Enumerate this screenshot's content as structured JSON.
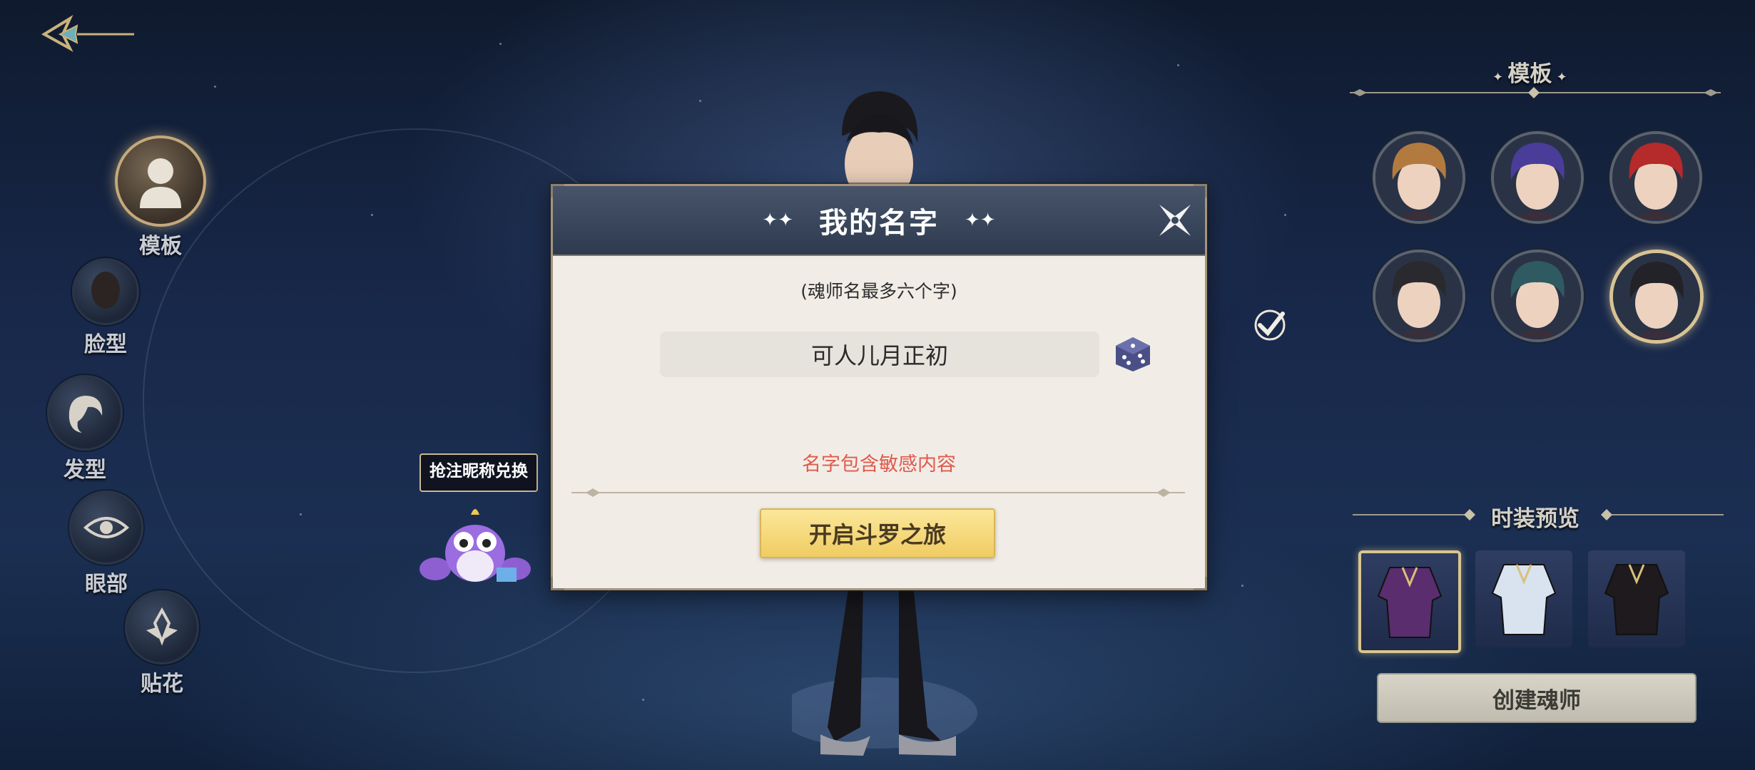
{
  "left_menu": {
    "items": [
      {
        "label": "模板",
        "icon": "person-silhouette-icon",
        "active": true
      },
      {
        "label": "脸型",
        "icon": "face-shape-icon",
        "active": false
      },
      {
        "label": "发型",
        "icon": "hairstyle-icon",
        "active": false
      },
      {
        "label": "眼部",
        "icon": "eye-icon",
        "active": false
      },
      {
        "label": "贴花",
        "icon": "decal-icon",
        "active": false
      }
    ]
  },
  "dialog": {
    "title": "我的名字",
    "hint": "(魂师名最多六个字)",
    "name_value": "可人儿月正初",
    "error": "名字包含敏感内容",
    "start_button": "开启斗罗之旅"
  },
  "mascot": {
    "badge": "抢注昵称兑换"
  },
  "right_panel": {
    "template_title": "模板",
    "templates": [
      {
        "hair": "#b37a3f",
        "selected": false
      },
      {
        "hair": "#4a3d9a",
        "selected": false
      },
      {
        "hair": "#b52a2a",
        "selected": false
      },
      {
        "hair": "#2a2a2e",
        "selected": false
      },
      {
        "hair": "#2f5a62",
        "selected": false
      },
      {
        "hair": "#222228",
        "selected": true
      }
    ],
    "outfit_title": "时装预览",
    "outfits": [
      {
        "color": "#5a2d6e",
        "selected": true
      },
      {
        "color": "#d9e2ef",
        "selected": false
      },
      {
        "color": "#1e1a1e",
        "selected": false
      }
    ],
    "create_button": "创建魂师"
  },
  "colors": {
    "accent_gold": "#f0cc62",
    "error_red": "#e05a4e",
    "dialog_bg": "#f1ede6"
  }
}
